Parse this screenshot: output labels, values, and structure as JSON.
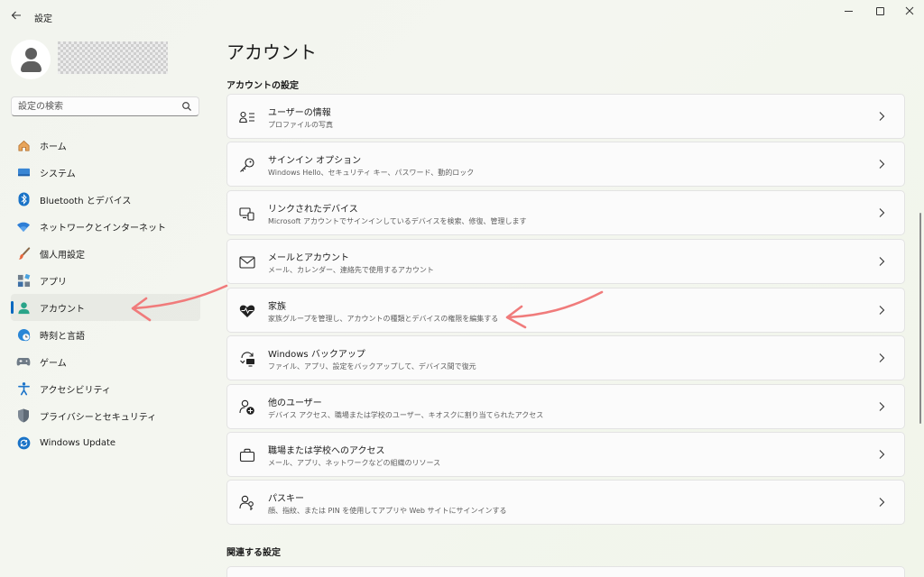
{
  "window": {
    "back_icon": "arrow-left-icon",
    "title": "設定",
    "controls": [
      "minimize-icon",
      "maximize-icon",
      "close-icon"
    ]
  },
  "profile": {
    "avatar_icon": "user-avatar-icon"
  },
  "search": {
    "placeholder": "設定の検索",
    "icon": "search-icon"
  },
  "nav": {
    "items": [
      {
        "label": "ホーム",
        "icon": "home-icon",
        "active": false
      },
      {
        "label": "システム",
        "icon": "monitor-icon",
        "active": false
      },
      {
        "label": "Bluetooth とデバイス",
        "icon": "bluetooth-icon",
        "active": false
      },
      {
        "label": "ネットワークとインターネット",
        "icon": "wifi-icon",
        "active": false
      },
      {
        "label": "個人用設定",
        "icon": "brush-icon",
        "active": false
      },
      {
        "label": "アプリ",
        "icon": "apps-icon",
        "active": false
      },
      {
        "label": "アカウント",
        "icon": "account-icon",
        "active": true
      },
      {
        "label": "時刻と言語",
        "icon": "clock-globe-icon",
        "active": false
      },
      {
        "label": "ゲーム",
        "icon": "gamepad-icon",
        "active": false
      },
      {
        "label": "アクセシビリティ",
        "icon": "accessibility-icon",
        "active": false
      },
      {
        "label": "プライバシーとセキュリティ",
        "icon": "shield-icon",
        "active": false
      },
      {
        "label": "Windows Update",
        "icon": "update-icon",
        "active": false
      }
    ]
  },
  "main": {
    "page_title": "アカウント",
    "section_title": "アカウントの設定",
    "cards": [
      {
        "title": "ユーザーの情報",
        "desc": "プロファイルの写真",
        "icon": "user-info-icon"
      },
      {
        "title": "サインイン オプション",
        "desc": "Windows Hello、セキュリティ キー、パスワード、動的ロック",
        "icon": "key-icon"
      },
      {
        "title": "リンクされたデバイス",
        "desc": "Microsoft アカウントでサインインしているデバイスを検索、修復、管理します",
        "icon": "linked-devices-icon"
      },
      {
        "title": "メールとアカウント",
        "desc": "メール、カレンダー、連絡先で使用するアカウント",
        "icon": "mail-icon"
      },
      {
        "title": "家族",
        "desc": "家族グループを管理し、アカウントの種類とデバイスの権限を編集する",
        "icon": "family-heart-icon"
      },
      {
        "title": "Windows バックアップ",
        "desc": "ファイル、アプリ、設定をバックアップして、デバイス間で復元",
        "icon": "backup-icon"
      },
      {
        "title": "他のユーザー",
        "desc": "デバイス アクセス、職場または学校のユーザー、キオスクに割り当てられたアクセス",
        "icon": "add-user-icon"
      },
      {
        "title": "職場または学校へのアクセス",
        "desc": "メール、アプリ、ネットワークなどの組織のリソース",
        "icon": "briefcase-icon"
      },
      {
        "title": "パスキー",
        "desc": "顔、指紋、または PIN を使用してアプリや Web サイトにサインインする",
        "icon": "passkey-icon"
      }
    ],
    "related_title": "関連する設定"
  },
  "annotations": {
    "color": "#f07b7b",
    "arrows": [
      "arrow-to-account-nav",
      "arrow-to-family-card"
    ]
  }
}
